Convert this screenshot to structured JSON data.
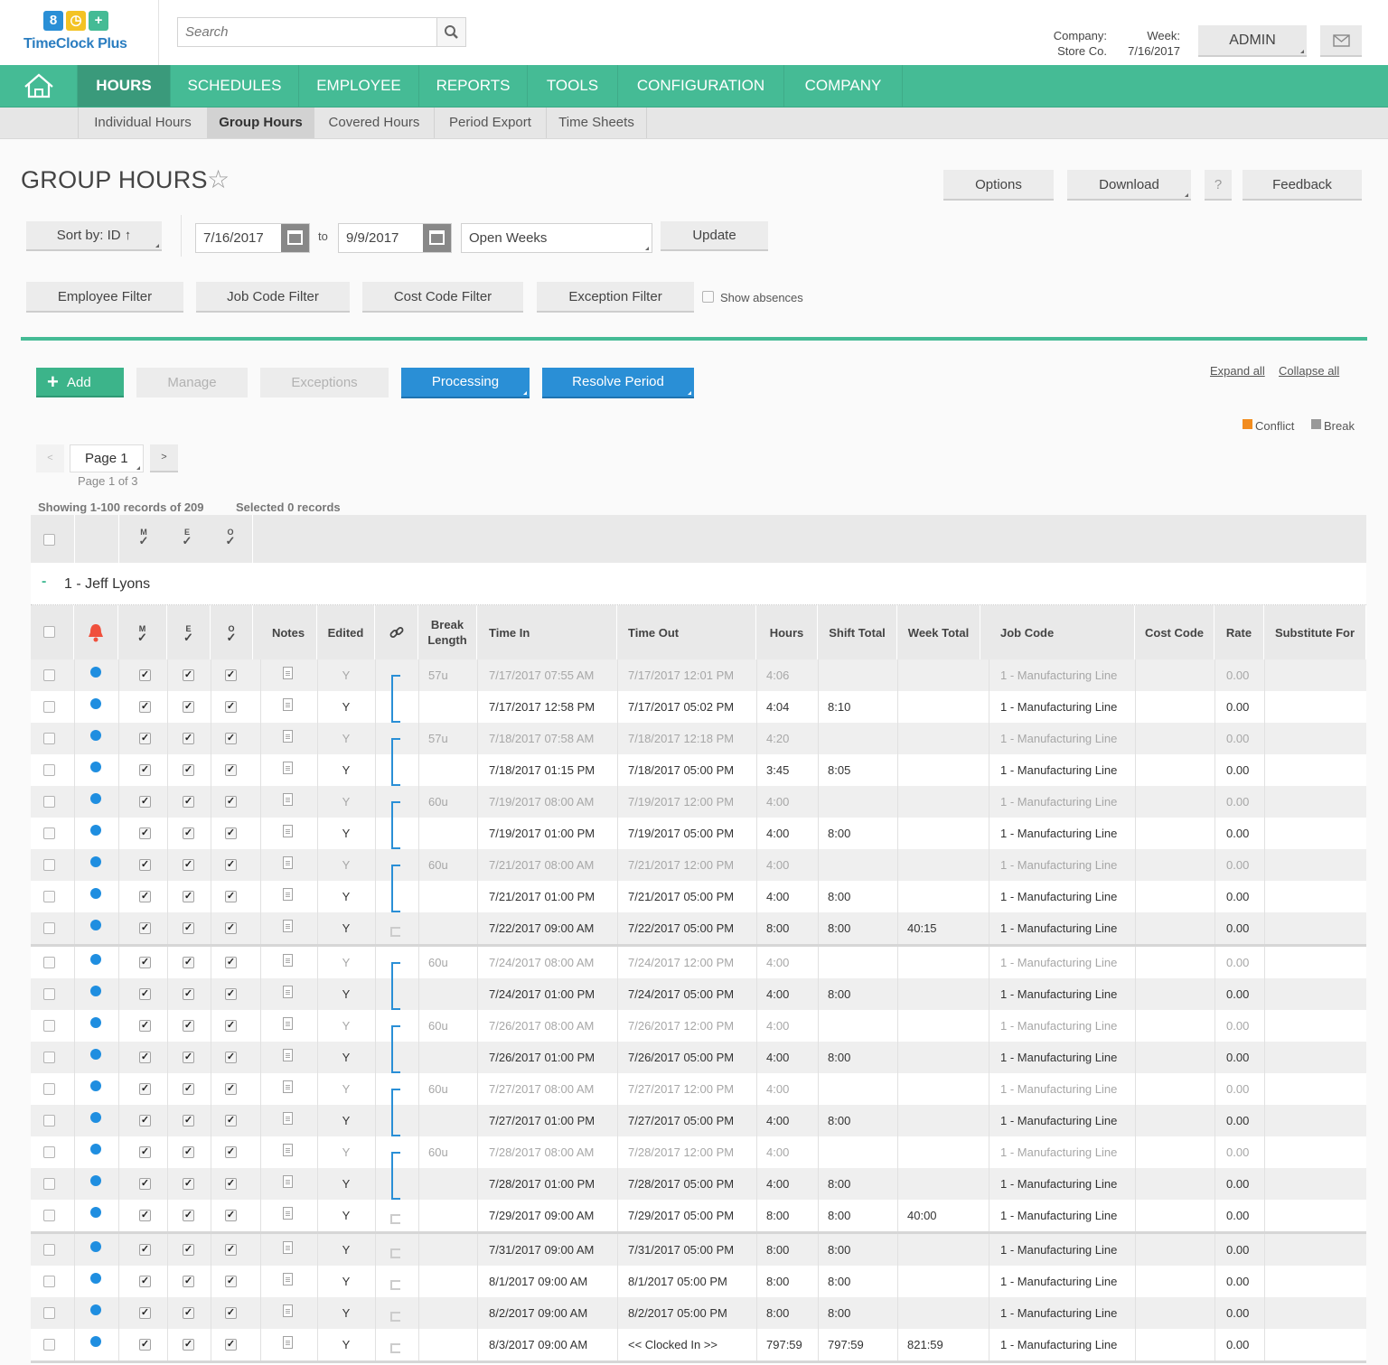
{
  "app": {
    "name": "TimeClock Plus",
    "logo_glyphs": [
      "8",
      "◷",
      "+"
    ]
  },
  "search": {
    "placeholder": "Search"
  },
  "header": {
    "company_label": "Company:",
    "company_value": "Store Co.",
    "week_label": "Week:",
    "week_value": "7/16/2017",
    "user_button": "ADMIN"
  },
  "nav": {
    "home_icon": "home-icon",
    "items": [
      "HOURS",
      "SCHEDULES",
      "EMPLOYEE",
      "REPORTS",
      "TOOLS",
      "CONFIGURATION",
      "COMPANY"
    ],
    "active": "HOURS"
  },
  "subnav": {
    "items": [
      "Individual Hours",
      "Group Hours",
      "Covered Hours",
      "Period Export",
      "Time Sheets"
    ],
    "active": "Group Hours"
  },
  "page": {
    "title": "GROUP HOURS",
    "favorite_glyph": "☆"
  },
  "toolbar": {
    "options": "Options",
    "download": "Download",
    "help": "?",
    "feedback": "Feedback"
  },
  "filters": {
    "sort": "Sort by: ID ↑",
    "date_from": "7/16/2017",
    "to_label": "to",
    "date_to": "9/9/2017",
    "period": "Open Weeks",
    "update": "Update",
    "employee_filter": "Employee Filter",
    "job_code_filter": "Job Code Filter",
    "cost_code_filter": "Cost Code Filter",
    "exception_filter": "Exception Filter",
    "show_absences": "Show absences"
  },
  "actions": {
    "add": "Add",
    "manage": "Manage",
    "exceptions": "Exceptions",
    "processing": "Processing",
    "resolve_period": "Resolve Period",
    "expand_all": "Expand all",
    "collapse_all": "Collapse all"
  },
  "legend": {
    "conflict": "Conflict",
    "break": "Break",
    "conflict_color": "#f28c1e",
    "break_color": "#999999"
  },
  "pager": {
    "prev": "<",
    "next": ">",
    "page": "Page 1",
    "page_of": "Page 1 of 3",
    "showing": "Showing 1-100 records of 209",
    "selected": "Selected 0 records"
  },
  "grid": {
    "top_header_marks": [
      "M",
      "E",
      "O"
    ],
    "group_toggle": "-",
    "group_name": "1 - Jeff Lyons",
    "columns": {
      "notes": "Notes",
      "edited": "Edited",
      "break_length": "Break Length",
      "time_in": "Time In",
      "time_out": "Time Out",
      "hours": "Hours",
      "shift_total": "Shift Total",
      "week_total": "Week Total",
      "job_code": "Job Code",
      "cost_code": "Cost Code",
      "rate": "Rate",
      "substitute_for": "Substitute For"
    },
    "rows": [
      {
        "edited": "Y",
        "brk": "57u",
        "tin": "7/17/2017 07:55 AM",
        "tout": "7/17/2017 12:01 PM",
        "hours": "4:06",
        "shift": "",
        "week": "",
        "job": "1 - Manufacturing Line",
        "rate": "0.00",
        "dim": true
      },
      {
        "edited": "Y",
        "brk": "",
        "tin": "7/17/2017 12:58 PM",
        "tout": "7/17/2017 05:02 PM",
        "hours": "4:04",
        "shift": "8:10",
        "week": "",
        "job": "1 - Manufacturing Line",
        "rate": "0.00",
        "dim": false
      },
      {
        "edited": "Y",
        "brk": "57u",
        "tin": "7/18/2017 07:58 AM",
        "tout": "7/18/2017 12:18 PM",
        "hours": "4:20",
        "shift": "",
        "week": "",
        "job": "1 - Manufacturing Line",
        "rate": "0.00",
        "dim": true
      },
      {
        "edited": "Y",
        "brk": "",
        "tin": "7/18/2017 01:15 PM",
        "tout": "7/18/2017 05:00 PM",
        "hours": "3:45",
        "shift": "8:05",
        "week": "",
        "job": "1 - Manufacturing Line",
        "rate": "0.00",
        "dim": false
      },
      {
        "edited": "Y",
        "brk": "60u",
        "tin": "7/19/2017 08:00 AM",
        "tout": "7/19/2017 12:00 PM",
        "hours": "4:00",
        "shift": "",
        "week": "",
        "job": "1 - Manufacturing Line",
        "rate": "0.00",
        "dim": true
      },
      {
        "edited": "Y",
        "brk": "",
        "tin": "7/19/2017 01:00 PM",
        "tout": "7/19/2017 05:00 PM",
        "hours": "4:00",
        "shift": "8:00",
        "week": "",
        "job": "1 - Manufacturing Line",
        "rate": "0.00",
        "dim": false
      },
      {
        "edited": "Y",
        "brk": "60u",
        "tin": "7/21/2017 08:00 AM",
        "tout": "7/21/2017 12:00 PM",
        "hours": "4:00",
        "shift": "",
        "week": "",
        "job": "1 - Manufacturing Line",
        "rate": "0.00",
        "dim": true
      },
      {
        "edited": "Y",
        "brk": "",
        "tin": "7/21/2017 01:00 PM",
        "tout": "7/21/2017 05:00 PM",
        "hours": "4:00",
        "shift": "8:00",
        "week": "",
        "job": "1 - Manufacturing Line",
        "rate": "0.00",
        "dim": false
      },
      {
        "edited": "Y",
        "brk": "",
        "tin": "7/22/2017 09:00 AM",
        "tout": "7/22/2017 05:00 PM",
        "hours": "8:00",
        "shift": "8:00",
        "week": "40:15",
        "job": "1 - Manufacturing Line",
        "rate": "0.00",
        "dim": false
      },
      {
        "edited": "Y",
        "brk": "60u",
        "tin": "7/24/2017 08:00 AM",
        "tout": "7/24/2017 12:00 PM",
        "hours": "4:00",
        "shift": "",
        "week": "",
        "job": "1 - Manufacturing Line",
        "rate": "0.00",
        "dim": true
      },
      {
        "edited": "Y",
        "brk": "",
        "tin": "7/24/2017 01:00 PM",
        "tout": "7/24/2017 05:00 PM",
        "hours": "4:00",
        "shift": "8:00",
        "week": "",
        "job": "1 - Manufacturing Line",
        "rate": "0.00",
        "dim": false
      },
      {
        "edited": "Y",
        "brk": "60u",
        "tin": "7/26/2017 08:00 AM",
        "tout": "7/26/2017 12:00 PM",
        "hours": "4:00",
        "shift": "",
        "week": "",
        "job": "1 - Manufacturing Line",
        "rate": "0.00",
        "dim": true
      },
      {
        "edited": "Y",
        "brk": "",
        "tin": "7/26/2017 01:00 PM",
        "tout": "7/26/2017 05:00 PM",
        "hours": "4:00",
        "shift": "8:00",
        "week": "",
        "job": "1 - Manufacturing Line",
        "rate": "0.00",
        "dim": false
      },
      {
        "edited": "Y",
        "brk": "60u",
        "tin": "7/27/2017 08:00 AM",
        "tout": "7/27/2017 12:00 PM",
        "hours": "4:00",
        "shift": "",
        "week": "",
        "job": "1 - Manufacturing Line",
        "rate": "0.00",
        "dim": true
      },
      {
        "edited": "Y",
        "brk": "",
        "tin": "7/27/2017 01:00 PM",
        "tout": "7/27/2017 05:00 PM",
        "hours": "4:00",
        "shift": "8:00",
        "week": "",
        "job": "1 - Manufacturing Line",
        "rate": "0.00",
        "dim": false
      },
      {
        "edited": "Y",
        "brk": "60u",
        "tin": "7/28/2017 08:00 AM",
        "tout": "7/28/2017 12:00 PM",
        "hours": "4:00",
        "shift": "",
        "week": "",
        "job": "1 - Manufacturing Line",
        "rate": "0.00",
        "dim": true
      },
      {
        "edited": "Y",
        "brk": "",
        "tin": "7/28/2017 01:00 PM",
        "tout": "7/28/2017 05:00 PM",
        "hours": "4:00",
        "shift": "8:00",
        "week": "",
        "job": "1 - Manufacturing Line",
        "rate": "0.00",
        "dim": false
      },
      {
        "edited": "Y",
        "brk": "",
        "tin": "7/29/2017 09:00 AM",
        "tout": "7/29/2017 05:00 PM",
        "hours": "8:00",
        "shift": "8:00",
        "week": "40:00",
        "job": "1 - Manufacturing Line",
        "rate": "0.00",
        "dim": false
      },
      {
        "edited": "Y",
        "brk": "",
        "tin": "7/31/2017 09:00 AM",
        "tout": "7/31/2017 05:00 PM",
        "hours": "8:00",
        "shift": "8:00",
        "week": "",
        "job": "1 - Manufacturing Line",
        "rate": "0.00",
        "dim": false
      },
      {
        "edited": "Y",
        "brk": "",
        "tin": "8/1/2017 09:00 AM",
        "tout": "8/1/2017 05:00 PM",
        "hours": "8:00",
        "shift": "8:00",
        "week": "",
        "job": "1 - Manufacturing Line",
        "rate": "0.00",
        "dim": false
      },
      {
        "edited": "Y",
        "brk": "",
        "tin": "8/2/2017 09:00 AM",
        "tout": "8/2/2017 05:00 PM",
        "hours": "8:00",
        "shift": "8:00",
        "week": "",
        "job": "1 - Manufacturing Line",
        "rate": "0.00",
        "dim": false
      },
      {
        "edited": "Y",
        "brk": "",
        "tin": "8/3/2017 09:00 AM",
        "tout": "<< Clocked In >>",
        "hours": "797:59",
        "shift": "797:59",
        "week": "821:59",
        "job": "1 - Manufacturing Line",
        "rate": "0.00",
        "dim": false
      }
    ]
  },
  "colors": {
    "brand_green": "#45bb95",
    "nav_active": "#3a9a7b",
    "primary_blue": "#2a8fd6",
    "status_dot": "#1f8ee0",
    "alarm_red": "#f0503c"
  }
}
